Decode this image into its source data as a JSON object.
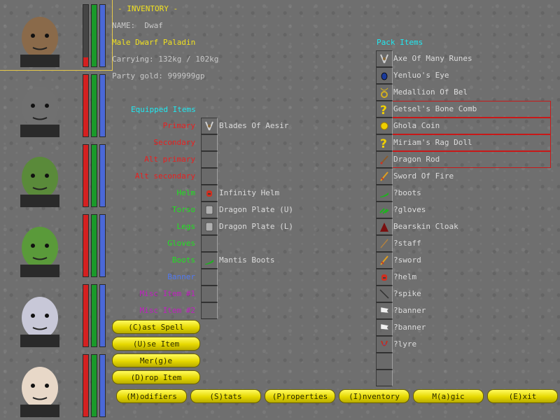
{
  "header": {
    "title": "- INVENTORY -",
    "name_label": "NAME:",
    "name_value": "Dwaf"
  },
  "character": {
    "race_class": "Male Dwarf Paladin",
    "carrying": "Carrying: 132kg / 102kg",
    "gold": "Party gold: 999999gp"
  },
  "party": [
    {
      "name": "dwarf-viking",
      "hp": 0.15,
      "st": 1.0,
      "mp": 1.0,
      "selected": true
    },
    {
      "name": "robot",
      "hp": 1.0,
      "st": 1.0,
      "mp": 1.0
    },
    {
      "name": "orc",
      "hp": 1.0,
      "st": 1.0,
      "mp": 1.0
    },
    {
      "name": "goblin",
      "hp": 1.0,
      "st": 1.0,
      "mp": 1.0
    },
    {
      "name": "ghost",
      "hp": 1.0,
      "st": 1.0,
      "mp": 1.0
    },
    {
      "name": "elf-woman",
      "hp": 1.0,
      "st": 1.0,
      "mp": 1.0
    }
  ],
  "equipped": {
    "title": "Equipped Items",
    "slots": [
      {
        "label": "Primary",
        "item": "Blades Of Aesir",
        "color": "#e82020",
        "icon": "crossed-blades-icon"
      },
      {
        "label": "Secondary",
        "item": "",
        "color": "#e82020",
        "icon": ""
      },
      {
        "label": "Alt primary",
        "item": "",
        "color": "#e82020",
        "icon": ""
      },
      {
        "label": "Alt secondary",
        "item": "",
        "color": "#e82020",
        "icon": ""
      },
      {
        "label": "Helm",
        "item": "Infinity Helm",
        "color": "#20e020",
        "icon": "helm-icon"
      },
      {
        "label": "Torso",
        "item": "Dragon Plate (U)",
        "color": "#20e020",
        "icon": "plate-armor-icon"
      },
      {
        "label": "Legs",
        "item": "Dragon Plate (L)",
        "color": "#20e020",
        "icon": "leg-armor-icon"
      },
      {
        "label": "Gloves",
        "item": "",
        "color": "#20e020",
        "icon": ""
      },
      {
        "label": "Boots",
        "item": "Mantis Boots",
        "color": "#20e020",
        "icon": "boots-icon"
      },
      {
        "label": "Banner",
        "item": "",
        "color": "#5078f0",
        "icon": ""
      },
      {
        "label": "Misc Item #1",
        "item": "",
        "color": "#c020c0",
        "icon": ""
      },
      {
        "label": "Misc Item #2",
        "item": "",
        "color": "#c020c0",
        "icon": ""
      }
    ]
  },
  "pack": {
    "title": "Pack Items",
    "items": [
      {
        "name": "Axe Of Many Runes",
        "icon": "axe-icon",
        "highlight": false
      },
      {
        "name": "Yenluo's Eye",
        "icon": "gem-icon",
        "highlight": false
      },
      {
        "name": "Medallion Of Bel",
        "icon": "medallion-icon",
        "highlight": false
      },
      {
        "name": "Getsel's Bone Comb",
        "icon": "question-mark-icon",
        "highlight": true
      },
      {
        "name": "Ghola Coin",
        "icon": "coin-icon",
        "highlight": true
      },
      {
        "name": "Miriam's Rag Doll",
        "icon": "question-mark-icon",
        "highlight": true
      },
      {
        "name": "Dragon Rod",
        "icon": "rod-icon",
        "highlight": true
      },
      {
        "name": "Sword Of Fire",
        "icon": "sword-icon",
        "highlight": false
      },
      {
        "name": "?boots",
        "icon": "boots-icon",
        "highlight": false
      },
      {
        "name": "?gloves",
        "icon": "gloves-icon",
        "highlight": false
      },
      {
        "name": "Bearskin Cloak",
        "icon": "cloak-icon",
        "highlight": false
      },
      {
        "name": "?staff",
        "icon": "staff-icon",
        "highlight": false
      },
      {
        "name": "?sword",
        "icon": "sword-icon",
        "highlight": false
      },
      {
        "name": "?helm",
        "icon": "helm-icon",
        "highlight": false
      },
      {
        "name": "?spike",
        "icon": "spike-icon",
        "highlight": false
      },
      {
        "name": "?banner",
        "icon": "banner-icon",
        "highlight": false
      },
      {
        "name": "?banner",
        "icon": "banner-icon",
        "highlight": false
      },
      {
        "name": "?lyre",
        "icon": "lyre-icon",
        "highlight": false
      },
      {
        "name": "",
        "icon": "",
        "highlight": false
      },
      {
        "name": "",
        "icon": "",
        "highlight": false
      }
    ]
  },
  "actions": {
    "cast": "(C)ast Spell",
    "use": "(U)se Item",
    "merge": "Mer(g)e",
    "drop": "(D)rop Item"
  },
  "menu": {
    "modifiers": "(M)odifiers",
    "stats": "(S)tats",
    "properties": "(P)roperties",
    "inventory": "(I)nventory",
    "magic": "M(a)gic",
    "exit": "(E)xit"
  }
}
